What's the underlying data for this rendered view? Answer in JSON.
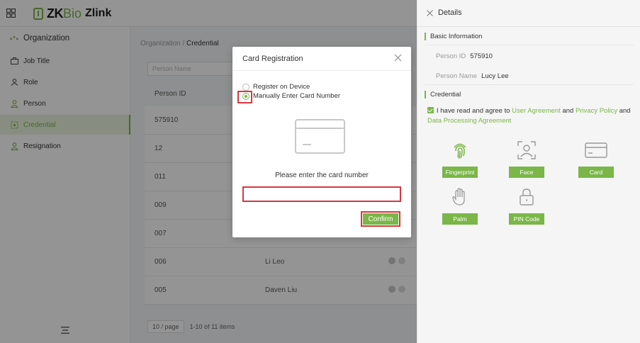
{
  "app": {
    "logo_zk": "ZK",
    "logo_bio": "Bio",
    "logo_zlink": "Zlink"
  },
  "sidebar": {
    "items": [
      {
        "label": "Organization"
      },
      {
        "label": "Job Title"
      },
      {
        "label": "Role"
      },
      {
        "label": "Person"
      },
      {
        "label": "Credential"
      },
      {
        "label": "Resignation"
      }
    ]
  },
  "main": {
    "breadcrumb_root": "Organization",
    "breadcrumb_sep": "/",
    "breadcrumb_current": "Credential",
    "search_placeholder": "Person Name",
    "columns": [
      "Person ID"
    ],
    "rows": [
      {
        "id": "575910",
        "name": ""
      },
      {
        "id": "12",
        "name": ""
      },
      {
        "id": "011",
        "name": ""
      },
      {
        "id": "009",
        "name": ""
      },
      {
        "id": "007",
        "name": ""
      },
      {
        "id": "006",
        "name": "Li Leo"
      },
      {
        "id": "005",
        "name": "Daven Liu"
      }
    ],
    "page_size": "10 / page",
    "page_summary": "1-10 of 11 items"
  },
  "modal": {
    "title": "Card Registration",
    "option_register": "Register on Device",
    "option_manual": "Manually Enter Card Number",
    "prompt": "Please enter the card number",
    "card_value": "",
    "confirm": "Confirm"
  },
  "details": {
    "title": "Details",
    "basic_info": "Basic Information",
    "person_id_label": "Person ID",
    "person_id": "575910",
    "person_name_label": "Person Name",
    "person_name": "Lucy Lee",
    "credential": "Credential",
    "agree_prefix": "I have read and agree to",
    "user_agreement": "User Agreement",
    "and1": "and",
    "privacy_policy": "Privacy Policy",
    "and2": "and",
    "data_agreement": "Data Processing Agreement",
    "credentials": [
      {
        "label": "Fingerprint",
        "icon": "fingerprint-icon"
      },
      {
        "label": "Face",
        "icon": "face-icon"
      },
      {
        "label": "Card",
        "icon": "card-icon"
      },
      {
        "label": "Palm",
        "icon": "palm-icon"
      },
      {
        "label": "PIN Code",
        "icon": "lock-icon"
      }
    ]
  },
  "colors": {
    "accent": "#7ab648",
    "highlight": "#d9363e"
  }
}
